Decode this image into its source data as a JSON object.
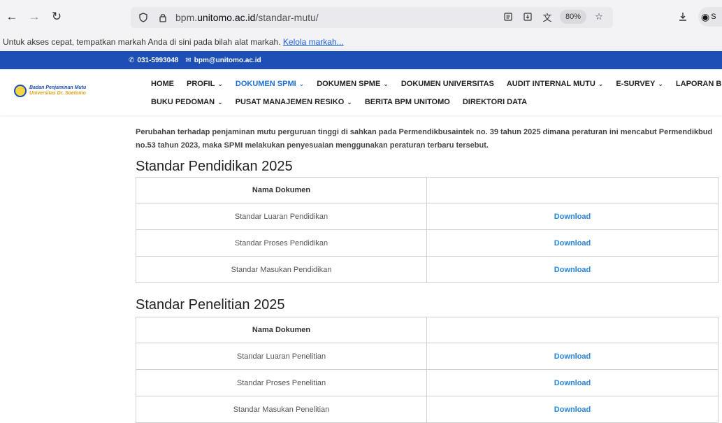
{
  "browser": {
    "url_prefix": "bpm.",
    "url_domain": "unitomo.ac.id",
    "url_path": "/standar-mutu/",
    "zoom": "80%",
    "account_letter": "S"
  },
  "bookmarks": {
    "text": "Untuk akses cepat, tempatkan markah Anda di sini pada bilah alat markah. ",
    "link": "Kelola markah..."
  },
  "topstrip": {
    "phone": "031-5993048",
    "email": "bpm@unitomo.ac.id"
  },
  "logo": {
    "line1": "Badan Penjaminan Mutu",
    "line2": "Universitas Dr. Soetomo"
  },
  "menu": {
    "row1": [
      "HOME",
      "PROFIL",
      "DOKUMEN SPMI",
      "DOKUMEN SPME",
      "DOKUMEN UNIVERSITAS",
      "AUDIT INTERNAL MUTU",
      "E-SURVEY",
      "LAPORAN BPM"
    ],
    "row2": [
      "BUKU PEDOMAN",
      "PUSAT MANAJEMEN RESIKO",
      "BERITA BPM UNITOMO",
      "DIREKTORI DATA"
    ]
  },
  "intro": "Perubahan terhadap penjaminan mutu perguruan tinggi di sahkan pada Permendikbusaintek no. 39 tahun 2025 dimana peraturan ini mencabut Permendikbud no.53 tahun 2023, maka SPMI melakukan penyesuaian menggunakan peraturan terbaru tersebut.",
  "sections": [
    {
      "title": "Standar Pendidikan 2025",
      "header": "Nama Dokumen",
      "rows": [
        {
          "name": "Standar Luaran Pendidikan",
          "action": "Download"
        },
        {
          "name": "Standar Proses Pendidikan",
          "action": "Download"
        },
        {
          "name": "Standar Masukan Pendidikan",
          "action": "Download"
        }
      ]
    },
    {
      "title": "Standar Penelitian 2025",
      "header": "Nama Dokumen",
      "rows": [
        {
          "name": "Standar Luaran Penelitian",
          "action": "Download"
        },
        {
          "name": "Standar Proses Penelitian",
          "action": "Download"
        },
        {
          "name": "Standar Masukan Penelitian",
          "action": "Download"
        }
      ]
    }
  ],
  "colors": {
    "brand_blue": "#1d4fb6",
    "active_menu": "#1d6fd6",
    "download_link": "#2a86dd"
  }
}
